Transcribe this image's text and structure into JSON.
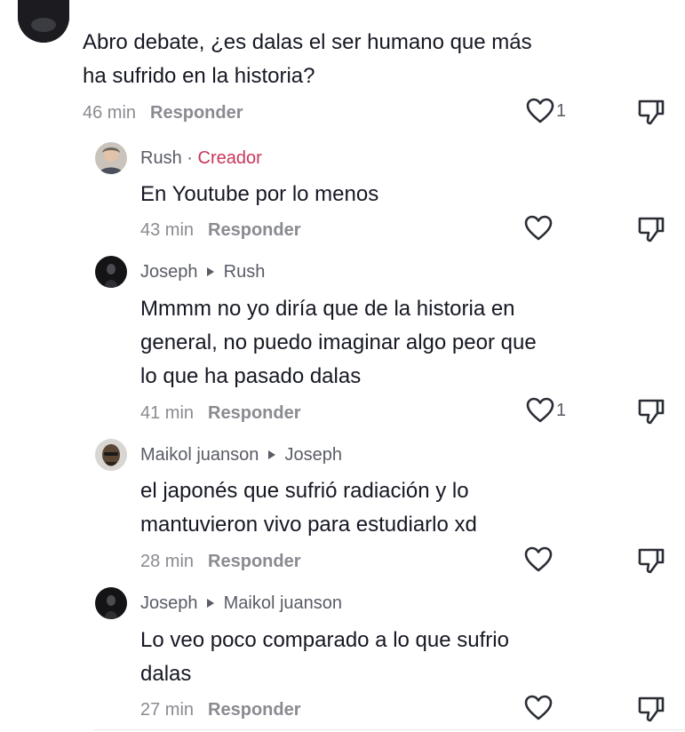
{
  "comments": [
    {
      "author": "",
      "text": "Abro debate, ¿es dalas el ser humano que más\nha sufrido en la historia?",
      "time": "46 min",
      "reply_label": "Responder",
      "likes": "1"
    },
    {
      "author": "Rush",
      "author_separator": "·",
      "author_badge": "Creador",
      "text": "En Youtube por lo menos",
      "time": "43 min",
      "reply_label": "Responder",
      "likes": ""
    },
    {
      "author": "Joseph",
      "reply_to": "Rush",
      "text": "Mmmm no yo diría que de la historia en\ngeneral, no puedo imaginar algo peor que\nlo que ha pasado dalas",
      "time": "41 min",
      "reply_label": "Responder",
      "likes": "1"
    },
    {
      "author": "Maikol juanson",
      "reply_to": "Joseph",
      "text": "el japonés que sufrió radiación y lo\nmantuvieron vivo para estudiarlo xd",
      "time": "28 min",
      "reply_label": "Responder",
      "likes": ""
    },
    {
      "author": "Joseph",
      "reply_to": "Maikol juanson",
      "text": "Lo veo poco comparado a lo que sufrio\ndalas",
      "time": "27 min",
      "reply_label": "Responder",
      "likes": ""
    }
  ],
  "icons": {
    "like": "heart-outline-icon",
    "dislike": "thumbs-down-icon",
    "reply_arrow": "triangle-right-icon"
  },
  "colors": {
    "creator_badge": "#c9355c",
    "meta_text": "#8a8b91",
    "author_text": "#5a5c66",
    "body_text": "#161823"
  }
}
